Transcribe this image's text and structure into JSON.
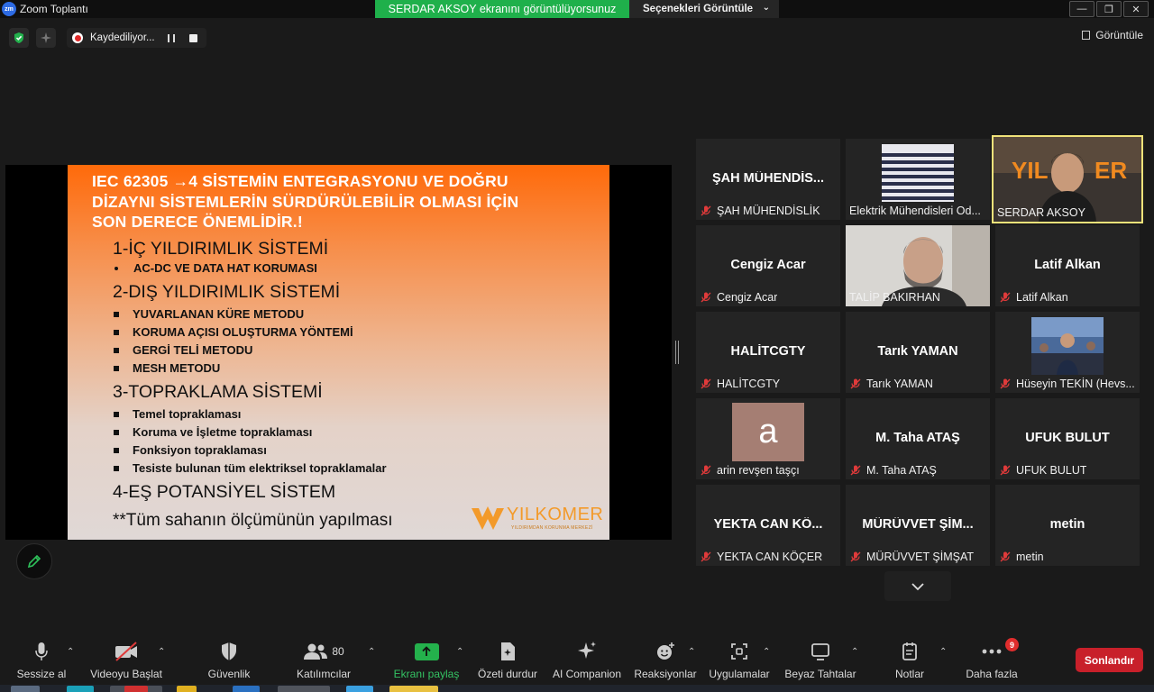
{
  "window": {
    "app_icon_text": "zm",
    "title": "Zoom Toplantı",
    "share_banner": "SERDAR AKSOY ekranını görüntülüyorsunuz",
    "view_options": "Seçenekleri Görüntüle",
    "minimize": "—",
    "restore": "❐",
    "close": "✕"
  },
  "status": {
    "recording_label": "Kaydediliyor...",
    "view_label": "Görüntüle"
  },
  "slide": {
    "title_line1": "IEC 62305 →4 SİSTEMİN ENTEGRASYONU VE DOĞRU",
    "title_line2": "DİZAYNI SİSTEMLERİN SÜRDÜRÜLEBİLİR OLMASI İÇİN",
    "title_line3": "SON DERECE ÖNEMLİDİR.!",
    "sections": [
      {
        "title": "1-İÇ YILDIRIMLIK  SİSTEMİ",
        "items": [
          "AC-DC VE DATA HAT KORUMASI"
        ]
      },
      {
        "title": "2-DIŞ YILDIRIMLIK SİSTEMİ",
        "items": [
          "YUVARLANAN KÜRE METODU",
          "KORUMA AÇISI OLUŞTURMA YÖNTEMİ",
          "GERGİ TELİ METODU",
          "MESH METODU"
        ]
      },
      {
        "title": "3-TOPRAKLAMA SİSTEMİ",
        "items": [
          "Temel topraklaması",
          "Koruma ve İşletme topraklaması",
          "Fonksiyon topraklaması",
          "Tesiste bulunan tüm elektriksel topraklamalar"
        ]
      },
      {
        "title": "4-EŞ POTANSİYEL SİSTEM",
        "items": []
      }
    ],
    "footer": "**Tüm sahanın ölçümünün yapılması",
    "brand_name": "YILKOMER",
    "brand_sub": "YILDIRIMDAN KORUNMA MERKEZİ"
  },
  "participants": [
    {
      "big": "ŞAH  MÜHENDİS...",
      "label": "ŞAH MÜHENDİSLİK",
      "muted": true
    },
    {
      "big": "",
      "label": "Elektrik Mühendisleri Od...",
      "muted": false
    },
    {
      "big": "",
      "label": "SERDAR AKSOY",
      "muted": false
    },
    {
      "big": "Cengiz Acar",
      "label": "Cengiz Acar",
      "muted": true
    },
    {
      "big": "",
      "label": "TALİP BAKIRHAN",
      "muted": false
    },
    {
      "big": "Latif Alkan",
      "label": "Latif Alkan",
      "muted": true
    },
    {
      "big": "HALİTCGTY",
      "label": "HALİTCGTY",
      "muted": true
    },
    {
      "big": "Tarık YAMAN",
      "label": "Tarık YAMAN",
      "muted": true
    },
    {
      "big": "",
      "label": "Hüseyin TEKİN (Hevs...",
      "muted": true
    },
    {
      "big": "",
      "label": "arin revşen taşçı",
      "muted": true,
      "avatar_letter": "a"
    },
    {
      "big": "M. Taha ATAŞ",
      "label": "M. Taha ATAŞ",
      "muted": true
    },
    {
      "big": "UFUK BULUT",
      "label": "UFUK BULUT",
      "muted": true
    },
    {
      "big": "YEKTA CAN  KÖ...",
      "label": "YEKTA CAN KÖÇER",
      "muted": true
    },
    {
      "big": "MÜRÜVVET  ŞİM...",
      "label": "MÜRÜVVET ŞİMŞAT",
      "muted": true
    },
    {
      "big": "metin",
      "label": "metin",
      "muted": true
    }
  ],
  "toolbar": {
    "mute": "Sessize al",
    "video": "Videoyu Başlat",
    "security": "Güvenlik",
    "participants": "Katılımcılar",
    "participants_count": "80",
    "share": "Ekranı paylaş",
    "summary": "Özeti durdur",
    "ai": "AI Companion",
    "reactions": "Reaksiyonlar",
    "apps": "Uygulamalar",
    "whiteboards": "Beyaz Tahtalar",
    "notes": "Notlar",
    "more": "Daha fazla",
    "more_badge": "9",
    "end": "Sonlandır"
  },
  "colors": {
    "share_banner": "#1fb04b",
    "end_button": "#c8202a",
    "slide_orange": "#ff6a0a",
    "active_speaker": "#f0e27a",
    "mute_red": "#e03a3a"
  }
}
